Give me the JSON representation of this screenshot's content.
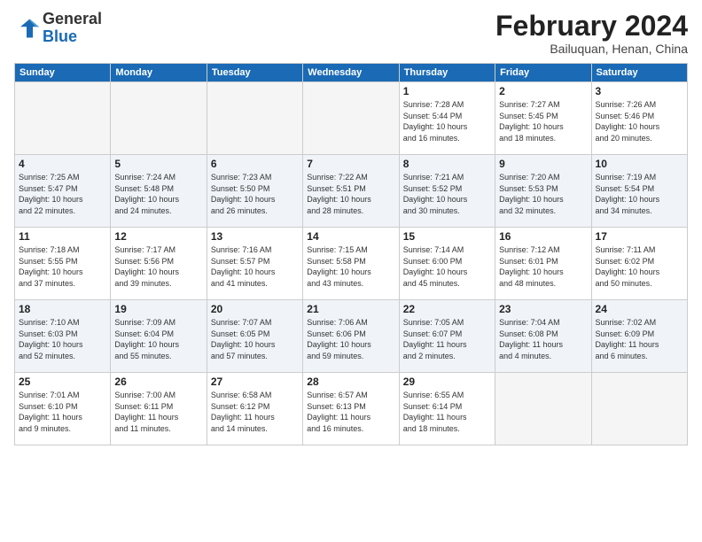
{
  "header": {
    "logo_general": "General",
    "logo_blue": "Blue",
    "main_title": "February 2024",
    "subtitle": "Bailuquan, Henan, China"
  },
  "weekdays": [
    "Sunday",
    "Monday",
    "Tuesday",
    "Wednesday",
    "Thursday",
    "Friday",
    "Saturday"
  ],
  "weeks": [
    [
      {
        "num": "",
        "info": ""
      },
      {
        "num": "",
        "info": ""
      },
      {
        "num": "",
        "info": ""
      },
      {
        "num": "",
        "info": ""
      },
      {
        "num": "1",
        "info": "Sunrise: 7:28 AM\nSunset: 5:44 PM\nDaylight: 10 hours\nand 16 minutes."
      },
      {
        "num": "2",
        "info": "Sunrise: 7:27 AM\nSunset: 5:45 PM\nDaylight: 10 hours\nand 18 minutes."
      },
      {
        "num": "3",
        "info": "Sunrise: 7:26 AM\nSunset: 5:46 PM\nDaylight: 10 hours\nand 20 minutes."
      }
    ],
    [
      {
        "num": "4",
        "info": "Sunrise: 7:25 AM\nSunset: 5:47 PM\nDaylight: 10 hours\nand 22 minutes."
      },
      {
        "num": "5",
        "info": "Sunrise: 7:24 AM\nSunset: 5:48 PM\nDaylight: 10 hours\nand 24 minutes."
      },
      {
        "num": "6",
        "info": "Sunrise: 7:23 AM\nSunset: 5:50 PM\nDaylight: 10 hours\nand 26 minutes."
      },
      {
        "num": "7",
        "info": "Sunrise: 7:22 AM\nSunset: 5:51 PM\nDaylight: 10 hours\nand 28 minutes."
      },
      {
        "num": "8",
        "info": "Sunrise: 7:21 AM\nSunset: 5:52 PM\nDaylight: 10 hours\nand 30 minutes."
      },
      {
        "num": "9",
        "info": "Sunrise: 7:20 AM\nSunset: 5:53 PM\nDaylight: 10 hours\nand 32 minutes."
      },
      {
        "num": "10",
        "info": "Sunrise: 7:19 AM\nSunset: 5:54 PM\nDaylight: 10 hours\nand 34 minutes."
      }
    ],
    [
      {
        "num": "11",
        "info": "Sunrise: 7:18 AM\nSunset: 5:55 PM\nDaylight: 10 hours\nand 37 minutes."
      },
      {
        "num": "12",
        "info": "Sunrise: 7:17 AM\nSunset: 5:56 PM\nDaylight: 10 hours\nand 39 minutes."
      },
      {
        "num": "13",
        "info": "Sunrise: 7:16 AM\nSunset: 5:57 PM\nDaylight: 10 hours\nand 41 minutes."
      },
      {
        "num": "14",
        "info": "Sunrise: 7:15 AM\nSunset: 5:58 PM\nDaylight: 10 hours\nand 43 minutes."
      },
      {
        "num": "15",
        "info": "Sunrise: 7:14 AM\nSunset: 6:00 PM\nDaylight: 10 hours\nand 45 minutes."
      },
      {
        "num": "16",
        "info": "Sunrise: 7:12 AM\nSunset: 6:01 PM\nDaylight: 10 hours\nand 48 minutes."
      },
      {
        "num": "17",
        "info": "Sunrise: 7:11 AM\nSunset: 6:02 PM\nDaylight: 10 hours\nand 50 minutes."
      }
    ],
    [
      {
        "num": "18",
        "info": "Sunrise: 7:10 AM\nSunset: 6:03 PM\nDaylight: 10 hours\nand 52 minutes."
      },
      {
        "num": "19",
        "info": "Sunrise: 7:09 AM\nSunset: 6:04 PM\nDaylight: 10 hours\nand 55 minutes."
      },
      {
        "num": "20",
        "info": "Sunrise: 7:07 AM\nSunset: 6:05 PM\nDaylight: 10 hours\nand 57 minutes."
      },
      {
        "num": "21",
        "info": "Sunrise: 7:06 AM\nSunset: 6:06 PM\nDaylight: 10 hours\nand 59 minutes."
      },
      {
        "num": "22",
        "info": "Sunrise: 7:05 AM\nSunset: 6:07 PM\nDaylight: 11 hours\nand 2 minutes."
      },
      {
        "num": "23",
        "info": "Sunrise: 7:04 AM\nSunset: 6:08 PM\nDaylight: 11 hours\nand 4 minutes."
      },
      {
        "num": "24",
        "info": "Sunrise: 7:02 AM\nSunset: 6:09 PM\nDaylight: 11 hours\nand 6 minutes."
      }
    ],
    [
      {
        "num": "25",
        "info": "Sunrise: 7:01 AM\nSunset: 6:10 PM\nDaylight: 11 hours\nand 9 minutes."
      },
      {
        "num": "26",
        "info": "Sunrise: 7:00 AM\nSunset: 6:11 PM\nDaylight: 11 hours\nand 11 minutes."
      },
      {
        "num": "27",
        "info": "Sunrise: 6:58 AM\nSunset: 6:12 PM\nDaylight: 11 hours\nand 14 minutes."
      },
      {
        "num": "28",
        "info": "Sunrise: 6:57 AM\nSunset: 6:13 PM\nDaylight: 11 hours\nand 16 minutes."
      },
      {
        "num": "29",
        "info": "Sunrise: 6:55 AM\nSunset: 6:14 PM\nDaylight: 11 hours\nand 18 minutes."
      },
      {
        "num": "",
        "info": ""
      },
      {
        "num": "",
        "info": ""
      }
    ]
  ]
}
